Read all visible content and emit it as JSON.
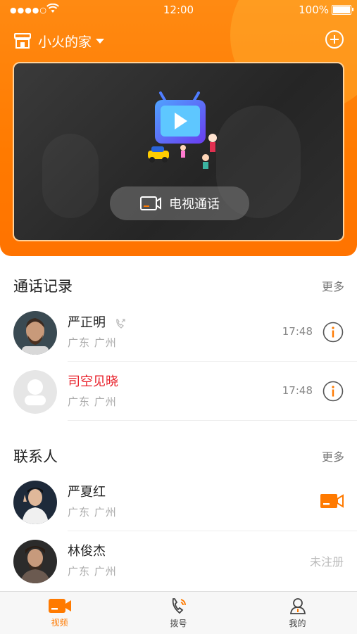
{
  "status_bar": {
    "time": "12:00",
    "battery": "100%",
    "signal_dots": "●●●●○"
  },
  "header": {
    "home_title": "小火的家",
    "tv_call_label": "电视通话"
  },
  "call_log": {
    "title": "通话记录",
    "more": "更多",
    "items": [
      {
        "name": "严正明",
        "location": "广东 广州",
        "time": "17:48"
      },
      {
        "name": "司空见晓",
        "location": "广东 广州",
        "time": "17:48"
      }
    ]
  },
  "contacts": {
    "title": "联系人",
    "more": "更多",
    "items": [
      {
        "name": "严夏红",
        "location": "广东 广州"
      },
      {
        "name": "林俊杰",
        "location": "广东 广州",
        "status": "未注册"
      }
    ]
  },
  "tabbar": {
    "items": [
      {
        "label": "视频",
        "icon": "video-camera-icon",
        "active": true
      },
      {
        "label": "拨号",
        "icon": "phone-dial-icon",
        "active": false
      },
      {
        "label": "我的",
        "icon": "person-icon",
        "active": false
      }
    ]
  },
  "colors": {
    "accent": "#ff7a00",
    "missed_call": "#e8202a"
  }
}
